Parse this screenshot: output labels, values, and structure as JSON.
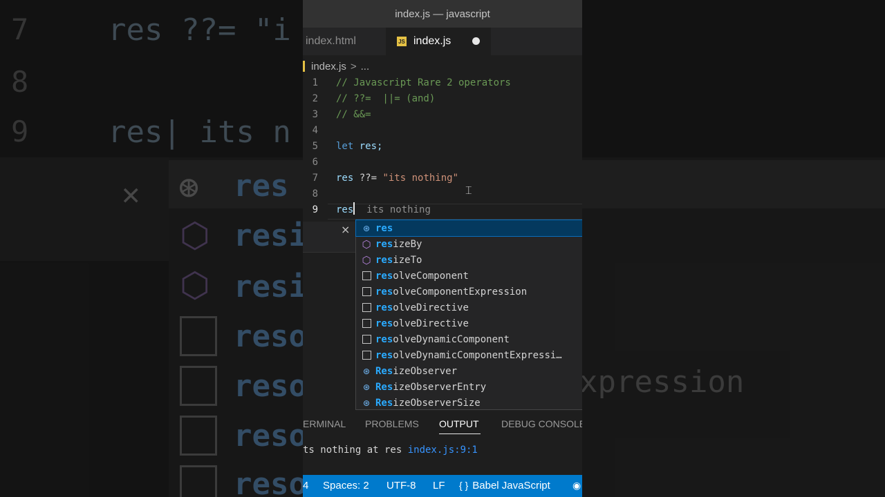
{
  "window": {
    "title": "index.js — javascript"
  },
  "tabs": [
    {
      "label": "index.html",
      "active": false
    },
    {
      "label": "index.js",
      "active": true,
      "dirty": true
    }
  ],
  "breadcrumb": {
    "file": "index.js",
    "separator": ">",
    "more": "..."
  },
  "editor": {
    "line_numbers": [
      "1",
      "2",
      "3",
      "4",
      "5",
      "6",
      "7",
      "8",
      "9"
    ],
    "lines": {
      "l1": "// Javascript Rare 2 operators",
      "l2": "// ??=  ||= (and)",
      "l3": "// &&=",
      "l5_kw": "let",
      "l5_var": " res;",
      "l7_var": "res",
      "l7_op": " ??= ",
      "l7_str": "\"its nothing\"",
      "l9_var": "res",
      "l9_ghost": "  its nothing"
    }
  },
  "peek": {
    "close": "×"
  },
  "suggestions": [
    {
      "icon": "variable-icon",
      "match": "res",
      "rest": "",
      "selected": true
    },
    {
      "icon": "method-icon",
      "match": "res",
      "rest": "izeBy"
    },
    {
      "icon": "method-icon",
      "match": "res",
      "rest": "izeTo"
    },
    {
      "icon": "box-icon",
      "match": "res",
      "rest": "olveComponent"
    },
    {
      "icon": "box-icon",
      "match": "res",
      "rest": "olveComponentExpression"
    },
    {
      "icon": "box-icon",
      "match": "res",
      "rest": "olveDirective"
    },
    {
      "icon": "box-icon",
      "match": "res",
      "rest": "olveDirective"
    },
    {
      "icon": "box-icon",
      "match": "res",
      "rest": "olveDynamicComponent"
    },
    {
      "icon": "box-icon",
      "match": "res",
      "rest": "olveDynamicComponentExpressi…"
    },
    {
      "icon": "variable-icon",
      "match": "Res",
      "rest": "izeObserver"
    },
    {
      "icon": "variable-icon",
      "match": "Res",
      "rest": "izeObserverEntry"
    },
    {
      "icon": "variable-icon",
      "match": "Res",
      "rest": "izeObserverSize"
    }
  ],
  "panel": {
    "tabs": [
      "ERMINAL",
      "PROBLEMS",
      "OUTPUT",
      "DEBUG CONSOLE"
    ],
    "active_tab": "OUTPUT",
    "output_text": "ts nothing at res ",
    "output_link": "index.js:9:1"
  },
  "statusbar": {
    "col": "4",
    "spaces": "Spaces: 2",
    "encoding": "UTF-8",
    "eol": "LF",
    "language": "Babel JavaScript"
  },
  "colors": {
    "statusbar": "#007acc",
    "selection": "#04395e",
    "match": "#2aaaff",
    "comment": "#6a9955",
    "string": "#ce9178",
    "keyword": "#569cd6",
    "js_badge": "#e5c144"
  }
}
